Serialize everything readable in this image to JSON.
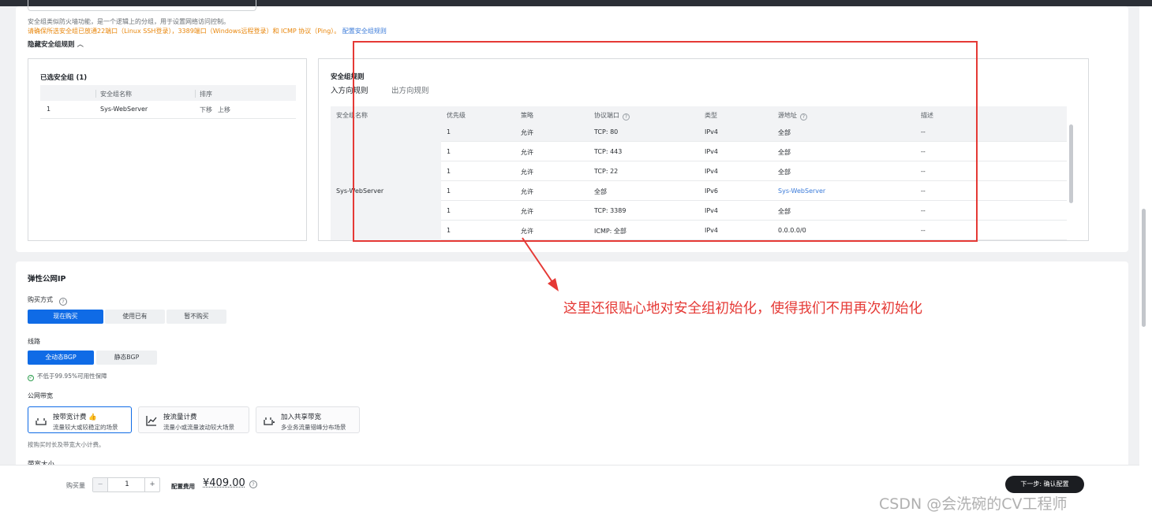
{
  "security": {
    "note_line1": "安全组类似防火墙功能，是一个逻辑上的分组，用于设置网络访问控制。",
    "note_line2": "请确保所选安全组已放通22端口（Linux SSH登录），3389端口（Windows远程登录）和 ICMP 协议（Ping）。",
    "config_link": "配置安全组规则",
    "collapse_toggle": "隐藏安全组规则",
    "selected_title": "已选安全组 (1)",
    "selected_headers": [
      "",
      "安全组名称",
      "排序"
    ],
    "selected_rows": [
      {
        "index": "1",
        "name": "Sys-WebServer",
        "down": "下移",
        "up": "上移"
      }
    ],
    "rules_title": "安全组规则",
    "tabs": [
      {
        "label": "入方向规则",
        "active": true
      },
      {
        "label": "出方向规则",
        "active": false
      }
    ],
    "rule_headers": [
      "安全组名称",
      "优先级",
      "策略",
      "协议端口",
      "类型",
      "源地址",
      "描述"
    ],
    "group_name": "Sys-WebServer",
    "rules": [
      {
        "priority": "1",
        "policy": "允许",
        "port": "TCP: 80",
        "type": "IPv4",
        "source": "全部",
        "desc": "--",
        "source_link": false
      },
      {
        "priority": "1",
        "policy": "允许",
        "port": "TCP: 443",
        "type": "IPv4",
        "source": "全部",
        "desc": "--",
        "source_link": false
      },
      {
        "priority": "1",
        "policy": "允许",
        "port": "TCP: 22",
        "type": "IPv4",
        "source": "全部",
        "desc": "--",
        "source_link": false
      },
      {
        "priority": "1",
        "policy": "允许",
        "port": "全部",
        "type": "IPv6",
        "source": "Sys-WebServer",
        "desc": "--",
        "source_link": true
      },
      {
        "priority": "1",
        "policy": "允许",
        "port": "TCP: 3389",
        "type": "IPv4",
        "source": "全部",
        "desc": "--",
        "source_link": false
      },
      {
        "priority": "1",
        "policy": "允许",
        "port": "ICMP: 全部",
        "type": "IPv4",
        "source": "0.0.0.0/0",
        "desc": "--",
        "source_link": false
      }
    ]
  },
  "annotation": {
    "text": "这里还很贴心地对安全组初始化，使得我们不用再次初始化",
    "color": "#e53935"
  },
  "eip": {
    "title": "弹性公网IP",
    "purchase_label": "购买方式",
    "purchase_options": [
      "现在购买",
      "使用已有",
      "暂不购买"
    ],
    "line_label": "线路",
    "line_options": [
      "全动态BGP",
      "静态BGP"
    ],
    "availability_note": "不低于99.95%可用性保障",
    "bandwidth_label": "公网带宽",
    "bandwidth_cards": [
      {
        "title": "按带宽计费",
        "sub": "流量较大或较稳定的场景",
        "icon": "bandwidth-meter-icon",
        "hot": true
      },
      {
        "title": "按流量计费",
        "sub": "流量小或流量波动较大场景",
        "icon": "traffic-chart-icon",
        "hot": false
      },
      {
        "title": "加入共享带宽",
        "sub": "多业务流量错峰分布场景",
        "icon": "shared-bandwidth-icon",
        "hot": false
      }
    ],
    "bandwidth_note": "按购买时长及带宽大小计费。",
    "size_label": "带宽大小"
  },
  "footer": {
    "qty_label": "购买量",
    "qty_minus": "−",
    "qty_value": "1",
    "qty_plus": "+",
    "fee_label": "配置费用",
    "fee_value": "¥409.00",
    "next_button": "下一步: 确认配置"
  },
  "watermark": "CSDN @会洗碗的CV工程师",
  "colors": {
    "accent": "#0f6be6",
    "warning": "#e8860b",
    "link": "#3b7bd9",
    "annotation_red": "#e53935"
  }
}
